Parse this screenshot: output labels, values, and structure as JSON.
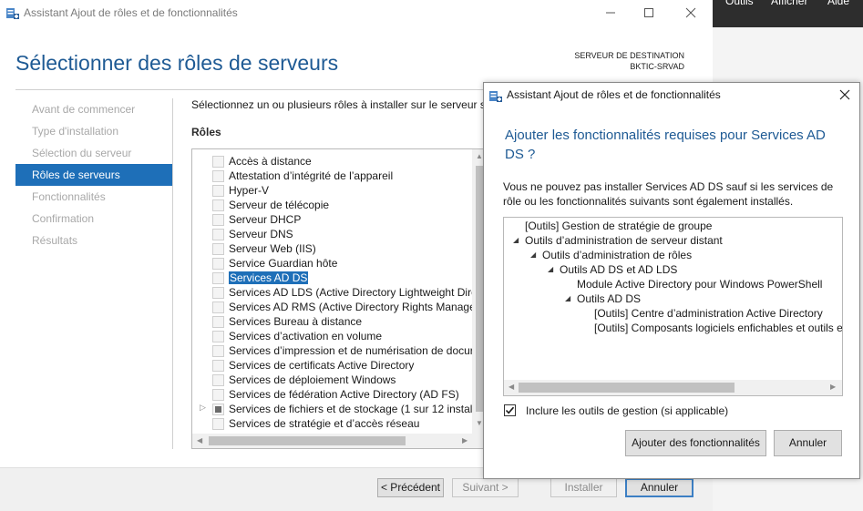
{
  "main_window": {
    "title": "Assistant Ajout de rôles et de fonctionnalités",
    "heading": "Sélectionner des rôles de serveurs",
    "destination_label": "SERVEUR DE DESTINATION",
    "destination_server": "BKTIC-SRVAD",
    "nav": [
      {
        "label": "Avant de commencer",
        "active": false
      },
      {
        "label": "Type d'installation",
        "active": false
      },
      {
        "label": "Sélection du serveur",
        "active": false
      },
      {
        "label": "Rôles de serveurs",
        "active": true
      },
      {
        "label": "Fonctionnalités",
        "active": false
      },
      {
        "label": "Confirmation",
        "active": false
      },
      {
        "label": "Résultats",
        "active": false
      }
    ],
    "intro_text": "Sélectionnez un ou plusieurs rôles à installer sur le serveur sé",
    "roles_label": "Rôles",
    "roles": [
      {
        "label": "Accès à distance",
        "state": "unchecked"
      },
      {
        "label": "Attestation d’intégrité de l’appareil",
        "state": "unchecked"
      },
      {
        "label": "Hyper-V",
        "state": "unchecked"
      },
      {
        "label": "Serveur de télécopie",
        "state": "unchecked"
      },
      {
        "label": "Serveur DHCP",
        "state": "unchecked"
      },
      {
        "label": "Serveur DNS",
        "state": "unchecked"
      },
      {
        "label": "Serveur Web (IIS)",
        "state": "unchecked"
      },
      {
        "label": "Service Guardian hôte",
        "state": "unchecked"
      },
      {
        "label": "Services AD DS",
        "state": "unchecked",
        "selected": true
      },
      {
        "label": "Services AD LDS (Active Directory Lightweight Dire",
        "state": "unchecked"
      },
      {
        "label": "Services AD RMS (Active Directory Rights Manager",
        "state": "unchecked"
      },
      {
        "label": "Services Bureau à distance",
        "state": "unchecked"
      },
      {
        "label": "Services d’activation en volume",
        "state": "unchecked"
      },
      {
        "label": "Services d’impression et de numérisation de docur",
        "state": "unchecked"
      },
      {
        "label": "Services de certificats Active Directory",
        "state": "unchecked"
      },
      {
        "label": "Services de déploiement Windows",
        "state": "unchecked"
      },
      {
        "label": "Services de fédération Active Directory (AD FS)",
        "state": "unchecked"
      },
      {
        "label": "Services de fichiers et de stockage (1 sur 12 installe",
        "state": "partial",
        "expandable": true
      },
      {
        "label": "Services de stratégie et d’accès réseau",
        "state": "unchecked"
      }
    ],
    "footer": {
      "previous": "< Précédent",
      "next": "Suivant >",
      "install": "Installer",
      "cancel": "Annuler"
    }
  },
  "background_app": {
    "menu": [
      "Outils",
      "Afficher",
      "Aide"
    ]
  },
  "dialog": {
    "title": "Assistant Ajout de rôles et de fonctionnalités",
    "heading": "Ajouter les fonctionnalités requises pour Services AD DS ?",
    "description": "Vous ne pouvez pas installer Services AD DS sauf si les services de rôle ou les fonctionnalités suivants sont également installés.",
    "tree": [
      {
        "label": "[Outils] Gestion de stratégie de groupe",
        "level": 0,
        "expandable": false
      },
      {
        "label": "Outils d’administration de serveur distant",
        "level": 0,
        "expandable": true
      },
      {
        "label": "Outils d’administration de rôles",
        "level": 1,
        "expandable": true
      },
      {
        "label": "Outils AD DS et AD LDS",
        "level": 2,
        "expandable": true
      },
      {
        "label": "Module Active Directory pour Windows PowerShell",
        "level": 3,
        "expandable": false
      },
      {
        "label": "Outils AD DS",
        "level": 3,
        "expandable": true
      },
      {
        "label": "[Outils] Centre d’administration Active Directory",
        "level": 4,
        "expandable": false
      },
      {
        "label": "[Outils] Composants logiciels enfichables et outils e",
        "level": 4,
        "expandable": false
      }
    ],
    "include_tools": {
      "label": "Inclure les outils de gestion (si applicable)",
      "checked": true
    },
    "add_button": "Ajouter des fonctionnalités",
    "cancel_button": "Annuler"
  },
  "colors": {
    "accent": "#1e6fb8",
    "heading": "#1e5a94",
    "nav_inactive": "#a8a8a8",
    "dark_bar": "#2d2d2d"
  }
}
